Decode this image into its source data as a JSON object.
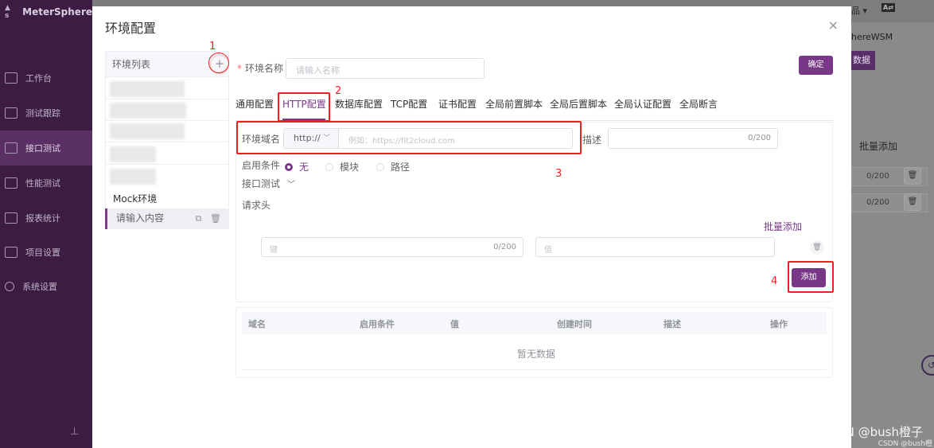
{
  "app": {
    "name": "MeterSphere"
  },
  "sidebar": {
    "items": [
      {
        "label": "工作台",
        "icon": "monitor-icon"
      },
      {
        "label": "测试跟踪",
        "icon": "clipboard-icon"
      },
      {
        "label": "接口测试",
        "icon": "api-icon"
      },
      {
        "label": "性能测试",
        "icon": "chart-icon"
      },
      {
        "label": "报表统计",
        "icon": "report-icon"
      },
      {
        "label": "项目设置",
        "icon": "folder-icon"
      },
      {
        "label": "系统设置",
        "icon": "gear-icon"
      }
    ],
    "active_index": 2
  },
  "background": {
    "top_right_text": "品 ▾",
    "workspace_text": "hereWSM",
    "data_button_label": "数据",
    "batch_add_label": "批量添加",
    "counter_1": "0/200",
    "counter_2": "0/200"
  },
  "dialog": {
    "title": "环境配置",
    "close": "×",
    "env_list": {
      "header": "环境列表",
      "add": "+",
      "mock_label": "Mock环境",
      "new_item_placeholder": "请输入内容"
    },
    "form": {
      "name_label": "环境名称",
      "name_placeholder": "请输入名称",
      "confirm_label": "确定",
      "tabs": [
        "通用配置",
        "HTTP配置",
        "数据库配置",
        "TCP配置",
        "证书配置",
        "全局前置脚本",
        "全局后置脚本",
        "全局认证配置",
        "全局断言"
      ],
      "active_tab": "HTTP配置",
      "domain_label": "环境域名",
      "protocol_value": "http://",
      "domain_placeholder": "例如：https://fit2cloud.com",
      "desc_label": "描述",
      "desc_counter": "0/200",
      "enable_label": "启用条件",
      "enable_options": [
        "无",
        "模块",
        "路径"
      ],
      "enable_selected": "无",
      "api_test_label": "接口测试",
      "headers_label": "请求头",
      "batch_add_label": "批量添加",
      "key_placeholder": "键",
      "key_counter": "0/200",
      "value_placeholder": "值",
      "add_button_label": "添加"
    },
    "table": {
      "columns": [
        "域名",
        "启用条件",
        "值",
        "创建时间",
        "描述",
        "操作"
      ],
      "empty_text": "暂无数据"
    }
  },
  "annotations": {
    "n1": "1",
    "n2": "2",
    "n3": "3",
    "n4": "4"
  },
  "watermark": "CSDN @bush橙子",
  "watermark_small": "CSDN @bush橙"
}
